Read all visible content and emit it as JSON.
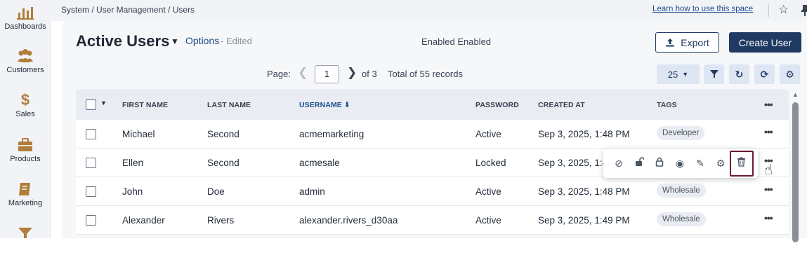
{
  "nav": {
    "items": [
      {
        "label": "Dashboards"
      },
      {
        "label": "Customers"
      },
      {
        "label": "Sales"
      },
      {
        "label": "Products"
      },
      {
        "label": "Marketing"
      }
    ]
  },
  "topbar": {
    "breadcrumb": "System / User Management / Users",
    "learn_link": "Learn how to use this space"
  },
  "header": {
    "title": "Active Users",
    "options": "Options",
    "edited": "- Edited",
    "enabled_text": "Enabled Enabled",
    "export_label": "Export",
    "create_label": "Create User"
  },
  "pagination": {
    "page_label": "Page:",
    "current_page": "1",
    "of_total": "of 3",
    "records": "Total of 55 records",
    "page_size": "25"
  },
  "table": {
    "columns": [
      "FIRST NAME",
      "LAST NAME",
      "USERNAME",
      "PASSWORD",
      "CREATED AT",
      "TAGS"
    ],
    "sorted_column": "USERNAME",
    "rows": [
      {
        "first": "Michael",
        "last": "Second",
        "username": "acmemarketing",
        "password": "Active",
        "created": "Sep 3, 2025, 1:48 PM",
        "tag": "Developer"
      },
      {
        "first": "Ellen",
        "last": "Second",
        "username": "acmesale",
        "password": "Locked",
        "created": "Sep 3, 2025, 1:4",
        "tag": ""
      },
      {
        "first": "John",
        "last": "Doe",
        "username": "admin",
        "password": "Active",
        "created": "Sep 3, 2025, 1:48 PM",
        "tag": "Wholesale"
      },
      {
        "first": "Alexander",
        "last": "Rivers",
        "username": "alexander.rivers_d30aa",
        "password": "Active",
        "created": "Sep 3, 2025, 1:49 PM",
        "tag": "Wholesale"
      }
    ]
  },
  "row_actions": [
    "disable-icon",
    "unlock-icon",
    "lock-icon",
    "view-icon",
    "edit-icon",
    "settings-icon",
    "delete-icon"
  ],
  "colors": {
    "primary": "#1f3b63",
    "link": "#1e4e8c",
    "highlight": "#6d1a36",
    "nav_icon": "#b07d3a"
  }
}
